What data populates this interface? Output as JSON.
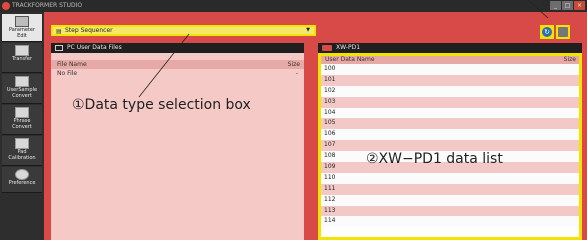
{
  "window": {
    "title": "TRACKFORMER STUDIO",
    "controls": [
      "_",
      "□",
      "×"
    ]
  },
  "sidebar": {
    "items": [
      {
        "label": "Parameter\nEdit",
        "icon": "parameter-edit-icon",
        "active": true
      },
      {
        "label": "Transfer",
        "icon": "transfer-icon",
        "active": false
      },
      {
        "label": "UserSample\nConvert",
        "icon": "user-sample-convert-icon",
        "active": false
      },
      {
        "label": "Phrase\nConvert",
        "icon": "phrase-convert-icon",
        "active": false
      },
      {
        "label": "Pad\nCalibration",
        "icon": "pad-calibration-icon",
        "active": false
      },
      {
        "label": "Preference",
        "icon": "gear-icon",
        "active": false
      }
    ]
  },
  "data_type_selector": {
    "value": "Step Sequencer",
    "icon": "sequencer-icon"
  },
  "pc_panel": {
    "title": "PC User Data Files",
    "columns": {
      "name": "File Name",
      "size": "Size"
    },
    "rows": [
      {
        "name": "No File",
        "size": "-"
      }
    ]
  },
  "xw_panel": {
    "title": "XW-PD1",
    "columns": {
      "name": "User Data Name",
      "size": "Size"
    },
    "rows": [
      "100",
      "101",
      "102",
      "103",
      "104",
      "105",
      "106",
      "107",
      "108",
      "109",
      "110",
      "111",
      "112",
      "113",
      "114"
    ]
  },
  "toolbar": {
    "refresh_icon": "refresh-icon",
    "trash_icon": "trash-icon"
  },
  "annotations": {
    "data_type": "①Data type selection box",
    "data_list": "②XW−PD1 data list"
  },
  "colors": {
    "main_red": "#d74a48",
    "highlight_yellow": "#f3e300",
    "list_pink": "#f4c9c6",
    "sidebar_dark": "#2e2e2e"
  }
}
